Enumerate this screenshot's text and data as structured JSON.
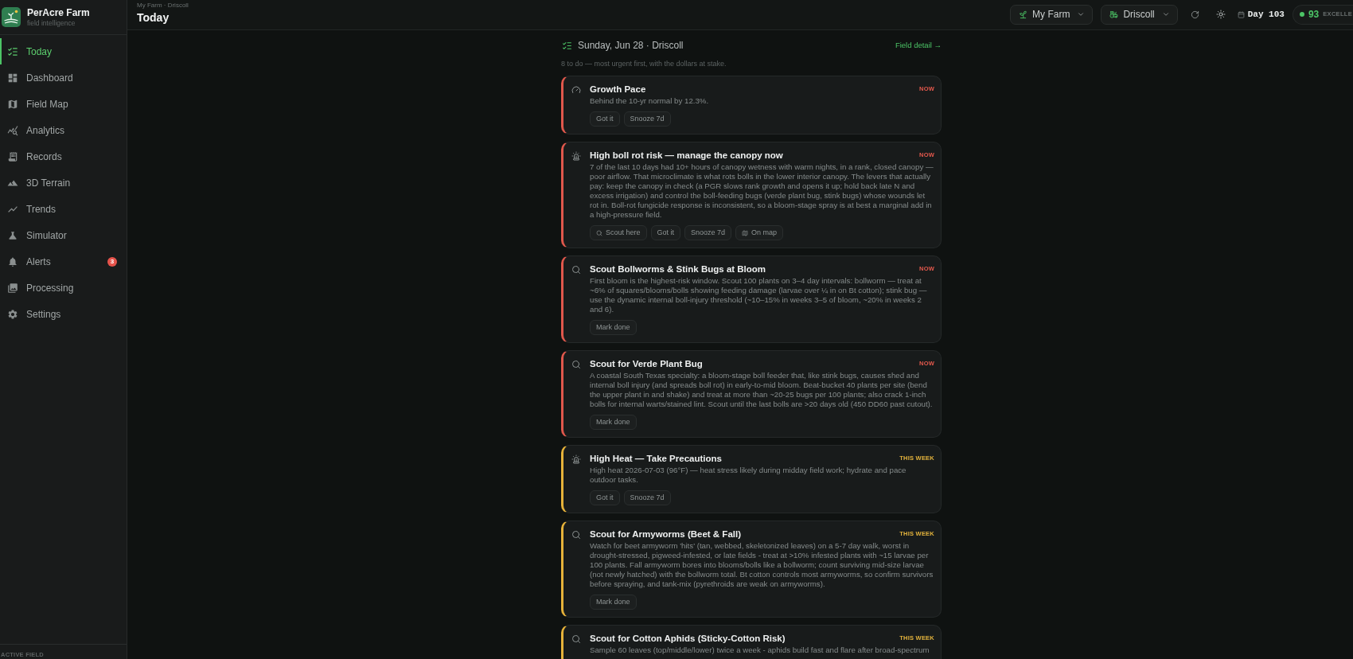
{
  "sidebar": {
    "brand": {
      "name": "PerAcre Farm",
      "tagline": "field intelligence"
    },
    "nav": [
      {
        "label": "Today",
        "selected": true
      },
      {
        "label": "Dashboard",
        "selected": false
      },
      {
        "label": "Field Map",
        "selected": false
      },
      {
        "label": "Analytics",
        "selected": false
      },
      {
        "label": "Records",
        "selected": false
      },
      {
        "label": "3D Terrain",
        "selected": false
      },
      {
        "label": "Trends",
        "selected": false
      },
      {
        "label": "Simulator",
        "selected": false
      },
      {
        "label": "Alerts",
        "selected": false,
        "badge": "3"
      },
      {
        "label": "Processing",
        "selected": false
      },
      {
        "label": "Settings",
        "selected": false
      }
    ],
    "footer_label": "ACTIVE FIELD"
  },
  "header": {
    "breadcrumb": "My Farm · Driscoll",
    "title": "Today",
    "farm_select": "My Farm",
    "field_select": "Driscoll",
    "day": "Day 103",
    "score": {
      "value": "93",
      "label": "EXCELLE"
    }
  },
  "agenda": {
    "date_heading": "Sunday, Jun 28 · Driscoll",
    "link": "Field detail →",
    "summary": "8 to do — most urgent first, with the dollars at stake.",
    "cards": [
      {
        "kind": "pace",
        "badge": {
          "kind": "now",
          "label": "NOW"
        },
        "title": "Growth Pace",
        "body": "Behind the 10-yr normal by 12.3%.",
        "actions": [
          {
            "kind": "ack",
            "label": "Got it"
          },
          {
            "kind": "snooze",
            "label": "Snooze 7d"
          }
        ]
      },
      {
        "kind": "alert",
        "badge": {
          "kind": "now",
          "label": "NOW"
        },
        "title": "High boll rot risk — manage the canopy now",
        "body": "7 of the last 10 days had 10+ hours of canopy wetness with warm nights, in a rank, closed canopy — poor airflow. That microclimate is what rots bolls in the lower interior canopy. The levers that actually pay: keep the canopy in check (a PGR slows rank growth and opens it up; hold back late N and excess irrigation) and control the boll-feeding bugs (verde plant bug, stink bugs) whose wounds let rot in. Boll-rot fungicide response is inconsistent, so a bloom-stage spray is at best a marginal add in a high-pressure field.",
        "actions": [
          {
            "kind": "scout",
            "label": "Scout here"
          },
          {
            "kind": "ack",
            "label": "Got it"
          },
          {
            "kind": "snooze",
            "label": "Snooze 7d"
          },
          {
            "kind": "map",
            "label": "On map"
          }
        ]
      },
      {
        "kind": "scout",
        "badge": {
          "kind": "now",
          "label": "NOW"
        },
        "title": "Scout Bollworms & Stink Bugs at Bloom",
        "body": "First bloom is the highest-risk window. Scout 100 plants on 3–4 day intervals: bollworm — treat at ~6% of squares/blooms/bolls showing feeding damage (larvae over ¼ in on Bt cotton); stink bug — use the dynamic internal boll-injury threshold (~10–15% in weeks 3–5 of bloom, ~20% in weeks 2 and 6).",
        "actions": [
          {
            "kind": "done",
            "label": "Mark done"
          }
        ]
      },
      {
        "kind": "scout",
        "badge": {
          "kind": "now",
          "label": "NOW"
        },
        "title": "Scout for Verde Plant Bug",
        "body": "A coastal South Texas specialty: a bloom-stage boll feeder that, like stink bugs, causes shed and internal boll injury (and spreads boll rot) in early-to-mid bloom. Beat-bucket 40 plants per site (bend the upper plant in and shake) and treat at more than ~20-25 bugs per 100 plants; also crack 1-inch bolls for internal warts/stained lint. Scout until the last bolls are >20 days old (450 DD60 past cutout).",
        "actions": [
          {
            "kind": "done",
            "label": "Mark done"
          }
        ]
      },
      {
        "kind": "alert",
        "badge": {
          "kind": "week",
          "label": "THIS WEEK"
        },
        "title": "High Heat — Take Precautions",
        "body": "High heat 2026-07-03 (96°F) — heat stress likely during midday field work; hydrate and pace outdoor tasks.",
        "actions": [
          {
            "kind": "ack",
            "label": "Got it"
          },
          {
            "kind": "snooze",
            "label": "Snooze 7d"
          }
        ]
      },
      {
        "kind": "scout",
        "badge": {
          "kind": "week",
          "label": "THIS WEEK"
        },
        "title": "Scout for Armyworms (Beet & Fall)",
        "body": "Watch for beet armyworm 'hits' (tan, webbed, skeletonized leaves) on a 5-7 day walk, worst in drought-stressed, pigweed-infested, or late fields - treat at >10% infested plants with ~15 larvae per 100 plants. Fall armyworm bores into blooms/bolls like a bollworm; count surviving mid-size larvae (not newly hatched) with the bollworm total. Bt cotton controls most armyworms, so confirm survivors before spraying, and tank-mix (pyrethroids are weak on armyworms).",
        "actions": [
          {
            "kind": "done",
            "label": "Mark done"
          }
        ]
      },
      {
        "kind": "scout",
        "badge": {
          "kind": "week",
          "label": "THIS WEEK"
        },
        "title": "Scout for Cotton Aphids (Sticky-Cotton Risk)",
        "body": "Sample 60 leaves (top/middle/lower) twice a week - aphids build fast and flare after broad-spectrum"
      }
    ]
  }
}
